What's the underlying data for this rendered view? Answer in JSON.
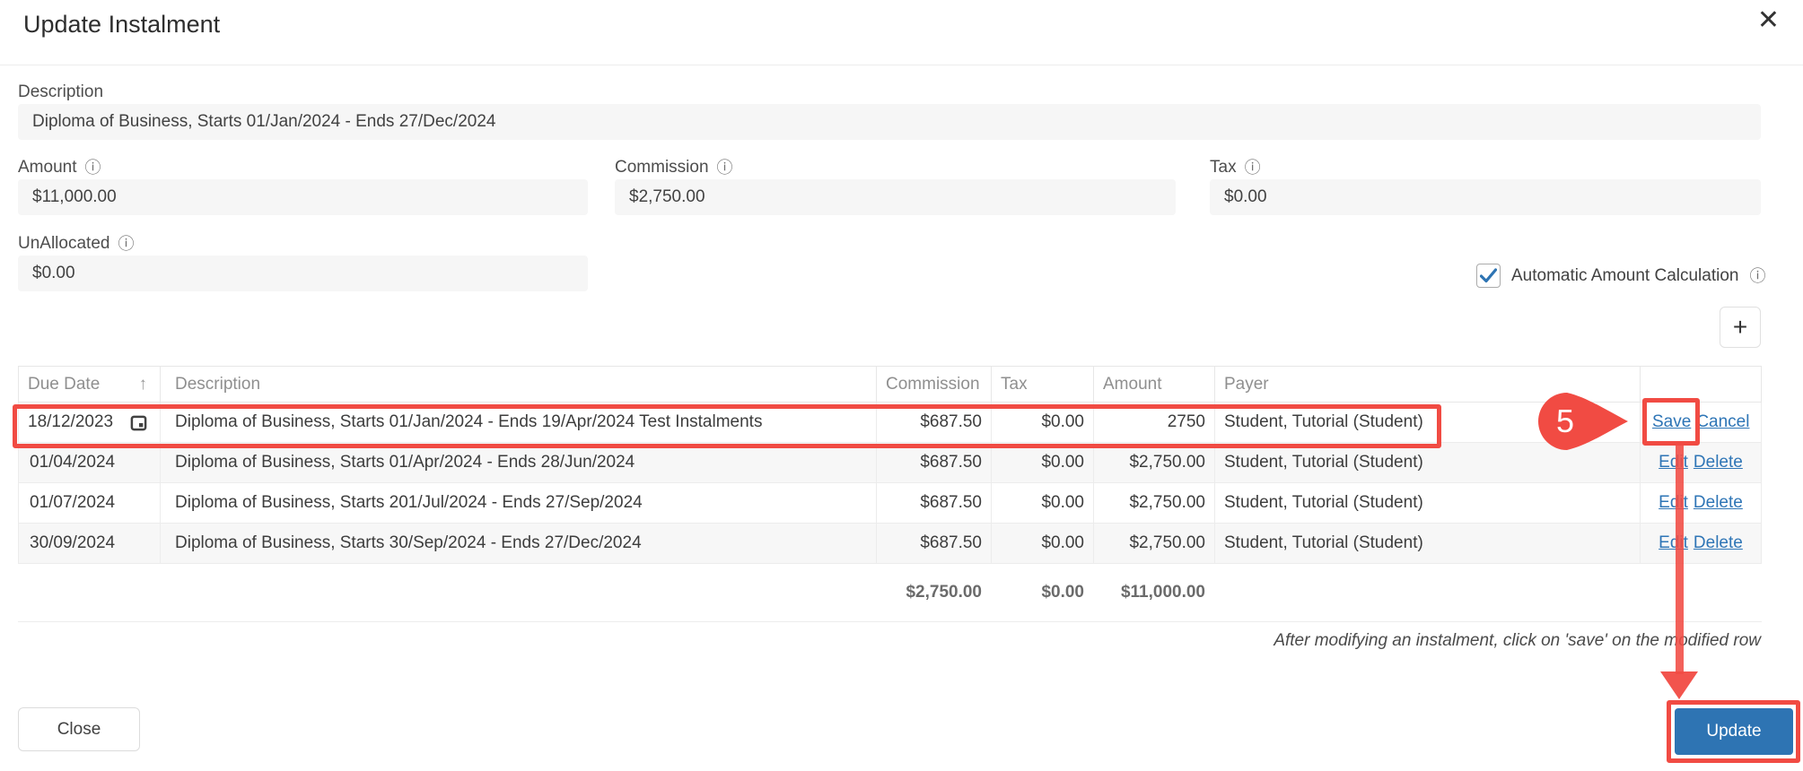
{
  "modal": {
    "title": "Update Instalment"
  },
  "icons": {
    "close": "✕",
    "info": "ⓘ",
    "sort_asc": "↑",
    "plus": "+"
  },
  "form": {
    "description": {
      "label": "Description",
      "value": "Diploma of Business, Starts 01/Jan/2024 - Ends 27/Dec/2024"
    },
    "amount": {
      "label": "Amount",
      "value": "$11,000.00"
    },
    "commission": {
      "label": "Commission",
      "value": "$2,750.00"
    },
    "tax": {
      "label": "Tax",
      "value": "$0.00"
    },
    "unallocated": {
      "label": "UnAllocated",
      "value": "$0.00"
    },
    "auto_calc": {
      "label": "Automatic Amount Calculation",
      "checked": true
    }
  },
  "table": {
    "headers": {
      "due_date": "Due Date",
      "description": "Description",
      "commission": "Commission",
      "tax": "Tax",
      "amount": "Amount",
      "payer": "Payer"
    },
    "rows": [
      {
        "due_date": "18/12/2023",
        "description": "Diploma of Business, Starts 01/Jan/2024 - Ends 19/Apr/2024 Test Instalments",
        "commission": "$687.50",
        "tax": "$0.00",
        "amount": "2750",
        "payer": "Student, Tutorial (Student)",
        "actions": [
          "Save",
          "Cancel"
        ]
      },
      {
        "due_date": "01/04/2024",
        "description": "Diploma of Business, Starts 01/Apr/2024 - Ends 28/Jun/2024",
        "commission": "$687.50",
        "tax": "$0.00",
        "amount": "$2,750.00",
        "payer": "Student, Tutorial (Student)",
        "actions": [
          "Edit",
          "Delete"
        ]
      },
      {
        "due_date": "01/07/2024",
        "description": "Diploma of Business, Starts 201/Jul/2024 - Ends 27/Sep/2024",
        "commission": "$687.50",
        "tax": "$0.00",
        "amount": "$2,750.00",
        "payer": "Student, Tutorial (Student)",
        "actions": [
          "Edit",
          "Delete"
        ]
      },
      {
        "due_date": "30/09/2024",
        "description": "Diploma of Business, Starts 30/Sep/2024 - Ends 27/Dec/2024",
        "commission": "$687.50",
        "tax": "$0.00",
        "amount": "$2,750.00",
        "payer": "Student, Tutorial (Student)",
        "actions": [
          "Edit",
          "Delete"
        ]
      }
    ],
    "footer": {
      "commission_total": "$2,750.00",
      "tax_total": "$0.00",
      "amount_total": "$11,000.00"
    }
  },
  "note": "After modifying an instalment, click on 'save' on the modified row",
  "buttons": {
    "close": "Close",
    "update": "Update"
  },
  "annotations": {
    "step_number": "5",
    "highlight_color": "#f14b43"
  }
}
